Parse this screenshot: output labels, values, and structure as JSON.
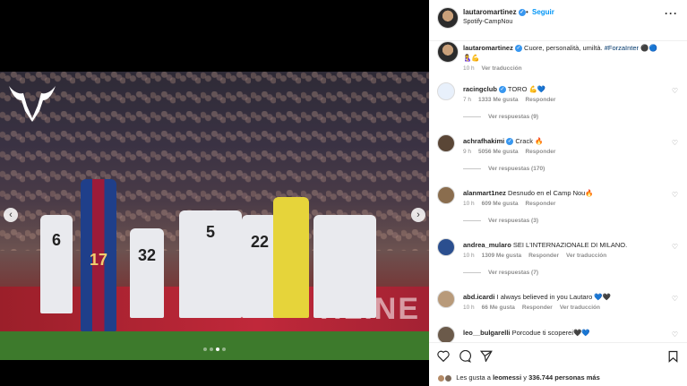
{
  "post": {
    "username": "lautaromartinez",
    "follow_label": "Seguir",
    "separator": "•",
    "location": "Spotify-CampNou",
    "more_label": "···"
  },
  "caption": {
    "username": "lautaromartinez",
    "text": "Cuore, personalità, umiltà.",
    "hashtag": "#ForzaInter",
    "emoji_line_1": "⚫🔵",
    "emoji_line_2": "🤱💪",
    "time": "10 h",
    "translate_label": "Ver traducción"
  },
  "comments": [
    {
      "username": "racingclub",
      "verified": true,
      "text": "TORO 💪💙",
      "time": "7 h",
      "likes": "1333 Me gusta",
      "reply": "Responder",
      "translate": "",
      "replies": "Ver respuestas (9)",
      "avatar_color": "#e8f0fb"
    },
    {
      "username": "achrafhakimi",
      "verified": true,
      "text": "Crack 🔥",
      "time": "9 h",
      "likes": "5056 Me gusta",
      "reply": "Responder",
      "translate": "",
      "replies": "Ver respuestas (170)",
      "avatar_color": "#5a4636"
    },
    {
      "username": "alanmart1nez",
      "verified": false,
      "text": "Desnudo en el Camp Nou🔥",
      "time": "10 h",
      "likes": "609 Me gusta",
      "reply": "Responder",
      "translate": "",
      "replies": "Ver respuestas (3)",
      "avatar_color": "#8a6d4e"
    },
    {
      "username": "andrea_mularo",
      "verified": false,
      "text": "SEI L'INTERNAZIONALE DI MILANO.",
      "time": "10 h",
      "likes": "1309 Me gusta",
      "reply": "Responder",
      "translate": "Ver traducción",
      "replies": "Ver respuestas (7)",
      "avatar_color": "#2b4f8f"
    },
    {
      "username": "abd.icardi",
      "verified": false,
      "text": "I always believed in you Lautaro 💙🖤",
      "time": "10 h",
      "likes": "66 Me gusta",
      "reply": "Responder",
      "translate": "Ver traducción",
      "replies": "",
      "avatar_color": "#b89a7a"
    },
    {
      "username": "leo__bulgarelli",
      "verified": false,
      "text": "Porcodue ti scoperei🖤💙",
      "time": "",
      "likes": "",
      "reply": "",
      "translate": "",
      "replies": "",
      "avatar_color": "#6b5a4a"
    }
  ],
  "actions": {
    "like_icon": "heart-icon",
    "comment_icon": "comment-icon",
    "share_icon": "share-icon",
    "save_icon": "bookmark-icon"
  },
  "likes_line": {
    "prefix": "Les gusta a",
    "user": "leomessi",
    "connector": "y",
    "count": "336.744 personas más"
  },
  "media": {
    "board_text": "HLINE",
    "players": [
      "6",
      "32",
      "17",
      "22",
      "5"
    ],
    "carousel_pages": 4,
    "carousel_active": 2
  },
  "colors": {
    "link_blue": "#0095f6",
    "verified_blue": "#3897f0",
    "muted": "#8e8e8e"
  }
}
